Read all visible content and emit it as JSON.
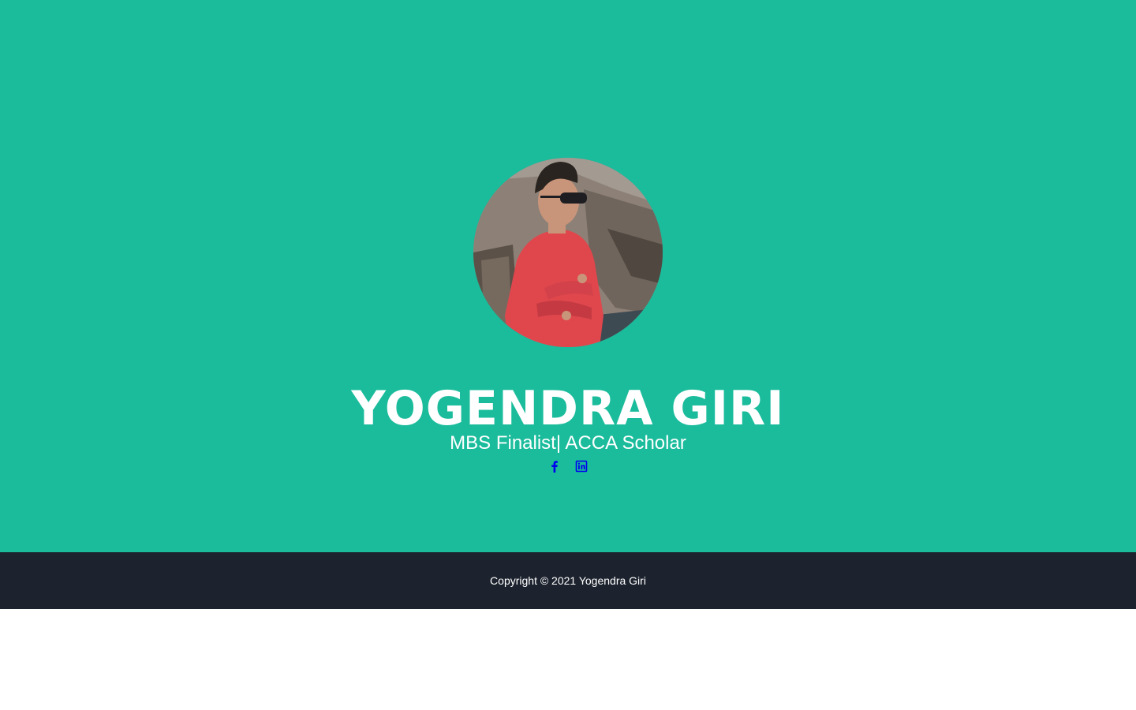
{
  "profile": {
    "name": "YOGENDRA GIRI",
    "subtitle": "MBS Finalist| ACCA Scholar",
    "avatar_alt": "Profile photo"
  },
  "social": {
    "facebook_label": "facebook",
    "linkedin_label": "linkedin",
    "icon_color": "#0000ee"
  },
  "footer": {
    "copyright": "Copyright © 2021 Yogendra Giri"
  },
  "colors": {
    "masthead_bg": "#1abc9c",
    "footer_bg": "#1d232e"
  }
}
